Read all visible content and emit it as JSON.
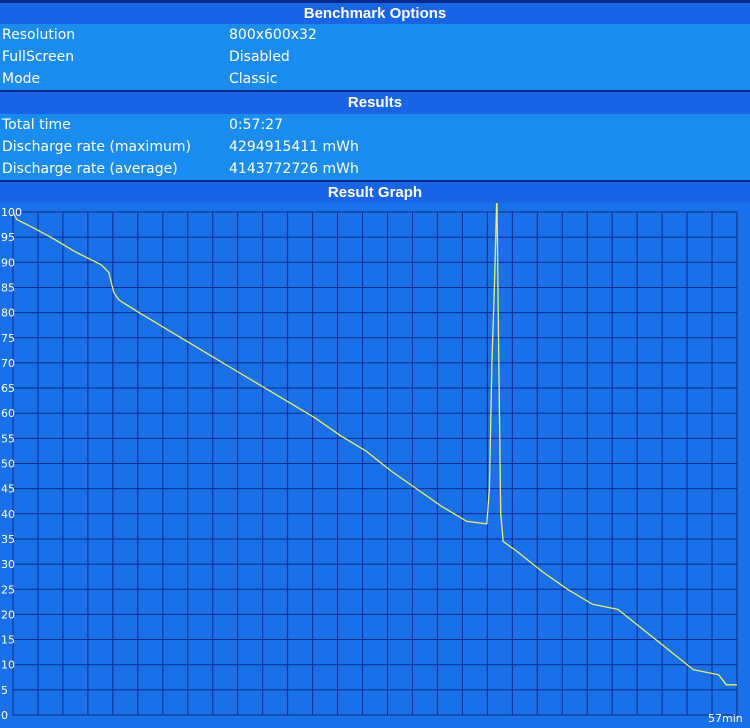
{
  "sections": {
    "options_title": "Benchmark Options",
    "results_title": "Results",
    "graph_title": "Result Graph"
  },
  "options": [
    {
      "label": "Resolution",
      "value": "800x600x32"
    },
    {
      "label": "FullScreen",
      "value": "Disabled"
    },
    {
      "label": "Mode",
      "value": "Classic"
    }
  ],
  "results": [
    {
      "label": "Total time",
      "value": "0:57:27"
    },
    {
      "label": "Discharge rate (maximum)",
      "value": "4294915411 mWh"
    },
    {
      "label": "Discharge rate (average)",
      "value": "4143772726 mWh"
    }
  ],
  "colors": {
    "background": "#0a2a8e",
    "header": "#1a64e6",
    "row": "#1a8cf0",
    "plot_bg": "#1a70e8",
    "grid": "#0a2a8e",
    "line": "#e6f06a"
  },
  "chart_data": {
    "type": "line",
    "title": "Result Graph",
    "xlabel": "",
    "ylabel": "",
    "x_end_label": "57min",
    "xlim": [
      0,
      57.45
    ],
    "ylim": [
      0,
      100
    ],
    "y_ticks": [
      0,
      5,
      10,
      15,
      20,
      25,
      30,
      35,
      40,
      45,
      50,
      55,
      60,
      65,
      70,
      75,
      80,
      85,
      90,
      95,
      100
    ],
    "grid": true,
    "series": [
      {
        "x": [
          0,
          0.3,
          1.5,
          3.0,
          5.0,
          7.0,
          7.6,
          8.0,
          8.4,
          10,
          12,
          14,
          16,
          18,
          20,
          22,
          24,
          26,
          28,
          30,
          32,
          34,
          36,
          37.6,
          37.8,
          38.0,
          38.2,
          38.4,
          38.5,
          38.7,
          38.9,
          40,
          42,
          44,
          46,
          48,
          50,
          52,
          54,
          56,
          56.6,
          57.45
        ],
        "y": [
          100,
          98.5,
          97,
          95,
          92,
          89.5,
          88,
          84,
          82.5,
          80,
          77,
          74,
          71,
          68,
          65,
          62,
          59,
          55.5,
          52.5,
          48.5,
          45,
          41.5,
          38.5,
          38,
          45,
          70,
          85,
          104,
          80,
          40,
          34.5,
          32.5,
          28.5,
          25,
          22,
          21,
          17,
          13,
          9,
          8,
          6,
          6
        ]
      }
    ]
  }
}
